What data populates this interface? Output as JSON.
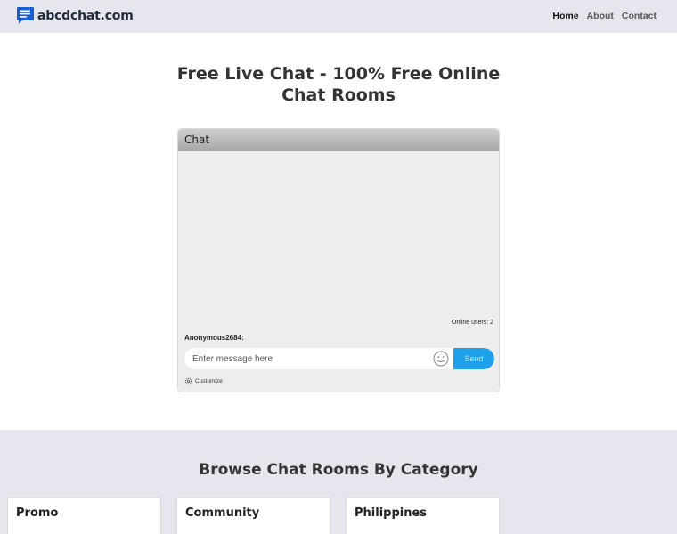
{
  "header": {
    "logo_text": "abcdchat.com",
    "logo_icon": "chat-bubble-icon",
    "brand_color": "#1a5fcf",
    "nav": [
      {
        "label": "Home",
        "active": true
      },
      {
        "label": "About",
        "active": false
      },
      {
        "label": "Contact",
        "active": false
      }
    ]
  },
  "main": {
    "title_line1": "Free Live Chat - 100% Free Online",
    "title_line2": "Chat Rooms"
  },
  "chat": {
    "title": "Chat",
    "online_users": "Online users: 2",
    "username": "Anonymous2684:",
    "message_placeholder": "Enter message here",
    "emoji_icon": "smiley-icon",
    "send_label": "Send",
    "send_color": "#1ea0ea",
    "customize_label": "Customize",
    "customize_icon": "gear-icon"
  },
  "browse": {
    "title": "Browse Chat Rooms By Category",
    "categories": [
      "Promo",
      "Community",
      "Philippines"
    ]
  }
}
